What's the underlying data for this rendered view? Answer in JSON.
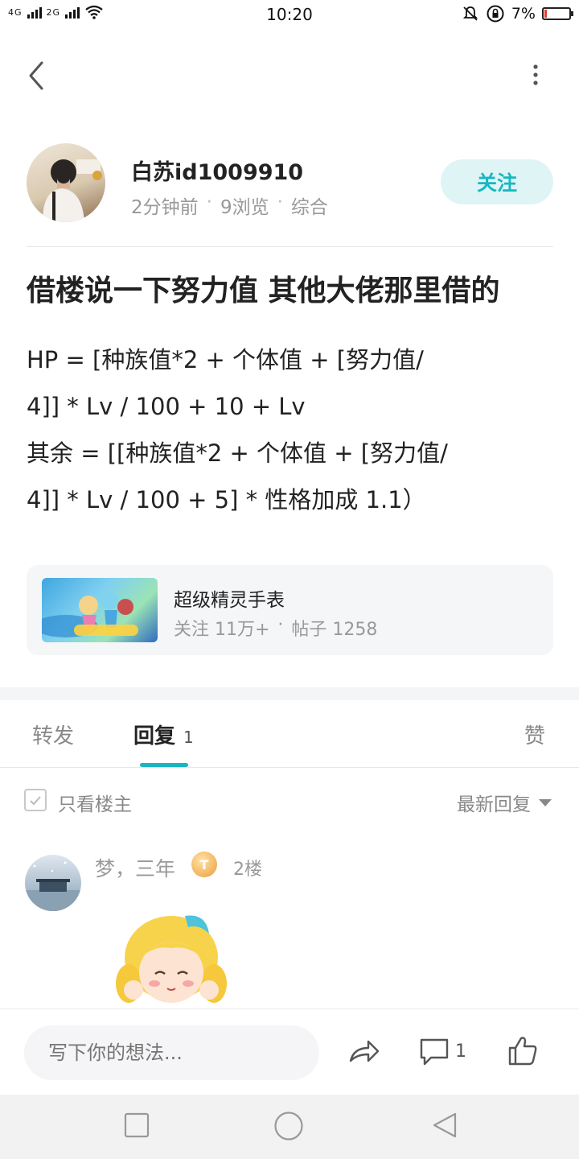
{
  "status_bar": {
    "network_1": "4G",
    "network_2": "2G",
    "time": "10:20",
    "battery_percent": "7%",
    "icons": [
      "signal-icon",
      "wifi-icon",
      "mute-icon",
      "rotation-lock-icon",
      "battery-icon"
    ]
  },
  "header": {
    "back_icon": "back-arrow-icon",
    "more_icon": "more-vertical-icon"
  },
  "post": {
    "author_name": "白苏id1009910",
    "time_ago": "2分钟前",
    "views": "9浏览",
    "category": "综合",
    "follow_label": "关注",
    "title": "借楼说一下努力值 其他大佬那里借的",
    "body_lines": [
      "HP = [种族值*2 + 个体值 + [努力值/",
      "4]] * Lv / 100 + 10 + Lv",
      "其余 = [[种族值*2 + 个体值 + [努力值/",
      "4]] * Lv / 100 + 5] * 性格加成 1.1）"
    ]
  },
  "forum": {
    "name": "超级精灵手表",
    "followers": "关注 11万+",
    "posts": "帖子 1258"
  },
  "tabs": {
    "forward": "转发",
    "reply": "回复",
    "reply_count": "1",
    "like": "赞"
  },
  "filter": {
    "only_op": "只看楼主",
    "sort_label": "最新回复"
  },
  "reply": {
    "name": "梦，三年",
    "badge": "T",
    "floor": "2楼"
  },
  "bottom_bar": {
    "input_placeholder": "写下你的想法...",
    "comment_count": "1"
  },
  "colors": {
    "accent": "#18b6c1",
    "follow_bg": "#dff4f5",
    "muted_text": "#999999"
  }
}
